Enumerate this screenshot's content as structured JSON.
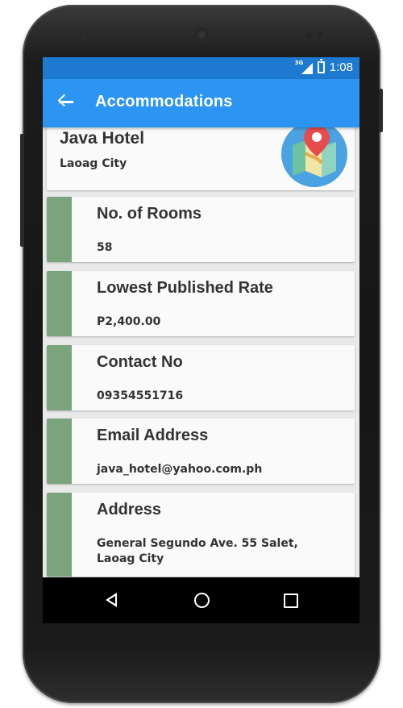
{
  "status_bar": {
    "network": "3G",
    "time": "1:08"
  },
  "app_bar": {
    "title": "Accommodations"
  },
  "hotel": {
    "name": "Java Hotel",
    "city": "Laoag City"
  },
  "details": [
    {
      "label": "No. of Rooms",
      "value": "58"
    },
    {
      "label": "Lowest Published Rate",
      "value": "P2,400.00"
    },
    {
      "label": "Contact No",
      "value": "09354551716"
    },
    {
      "label": "Email Address",
      "value": "java_hotel@yahoo.com.ph"
    },
    {
      "label": "Address",
      "value": "General Segundo Ave. 55 Salet, Laoag City"
    }
  ],
  "colors": {
    "app_bar": "#2c95f2",
    "status_bar": "#1e7ad0",
    "accent": "#7aa57c"
  }
}
